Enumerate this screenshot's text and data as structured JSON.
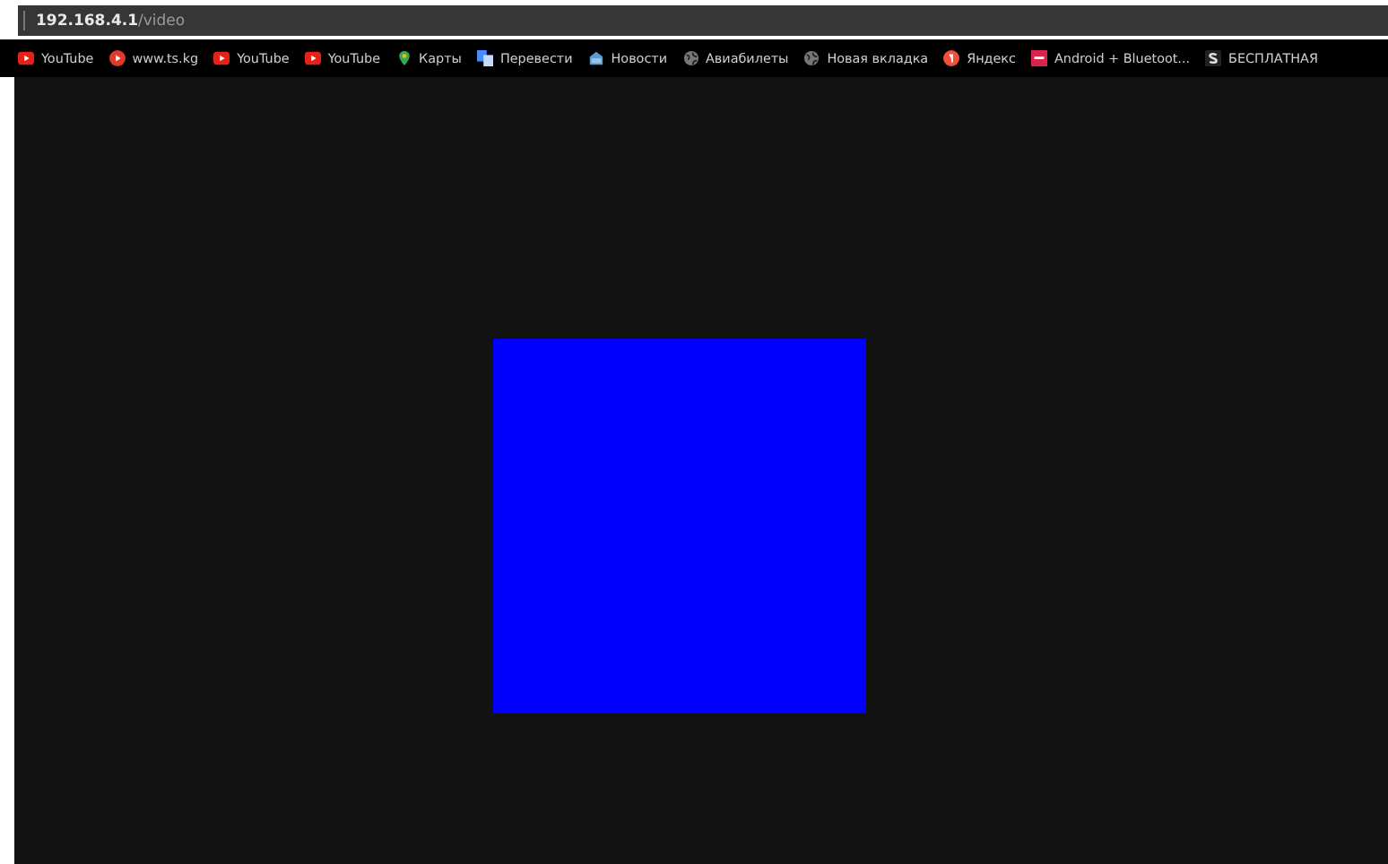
{
  "address_bar": {
    "host": "192.168.4.1",
    "path": "/video"
  },
  "bookmarks": [
    {
      "label": "YouTube",
      "kind": "youtube"
    },
    {
      "label": "www.ts.kg",
      "kind": "play"
    },
    {
      "label": "YouTube",
      "kind": "youtube"
    },
    {
      "label": "YouTube",
      "kind": "youtube"
    },
    {
      "label": "Карты",
      "kind": "pin"
    },
    {
      "label": "Перевести",
      "kind": "translate"
    },
    {
      "label": "Новости",
      "kind": "news"
    },
    {
      "label": "Авиабилеты",
      "kind": "globe"
    },
    {
      "label": "Новая вкладка",
      "kind": "globe"
    },
    {
      "label": "Яндекс",
      "kind": "yandex"
    },
    {
      "label": "Android + Bluetoot...",
      "kind": "tile"
    },
    {
      "label": "БЕСПЛАТНАЯ",
      "kind": "s"
    }
  ],
  "page": {
    "kind": "video"
  }
}
